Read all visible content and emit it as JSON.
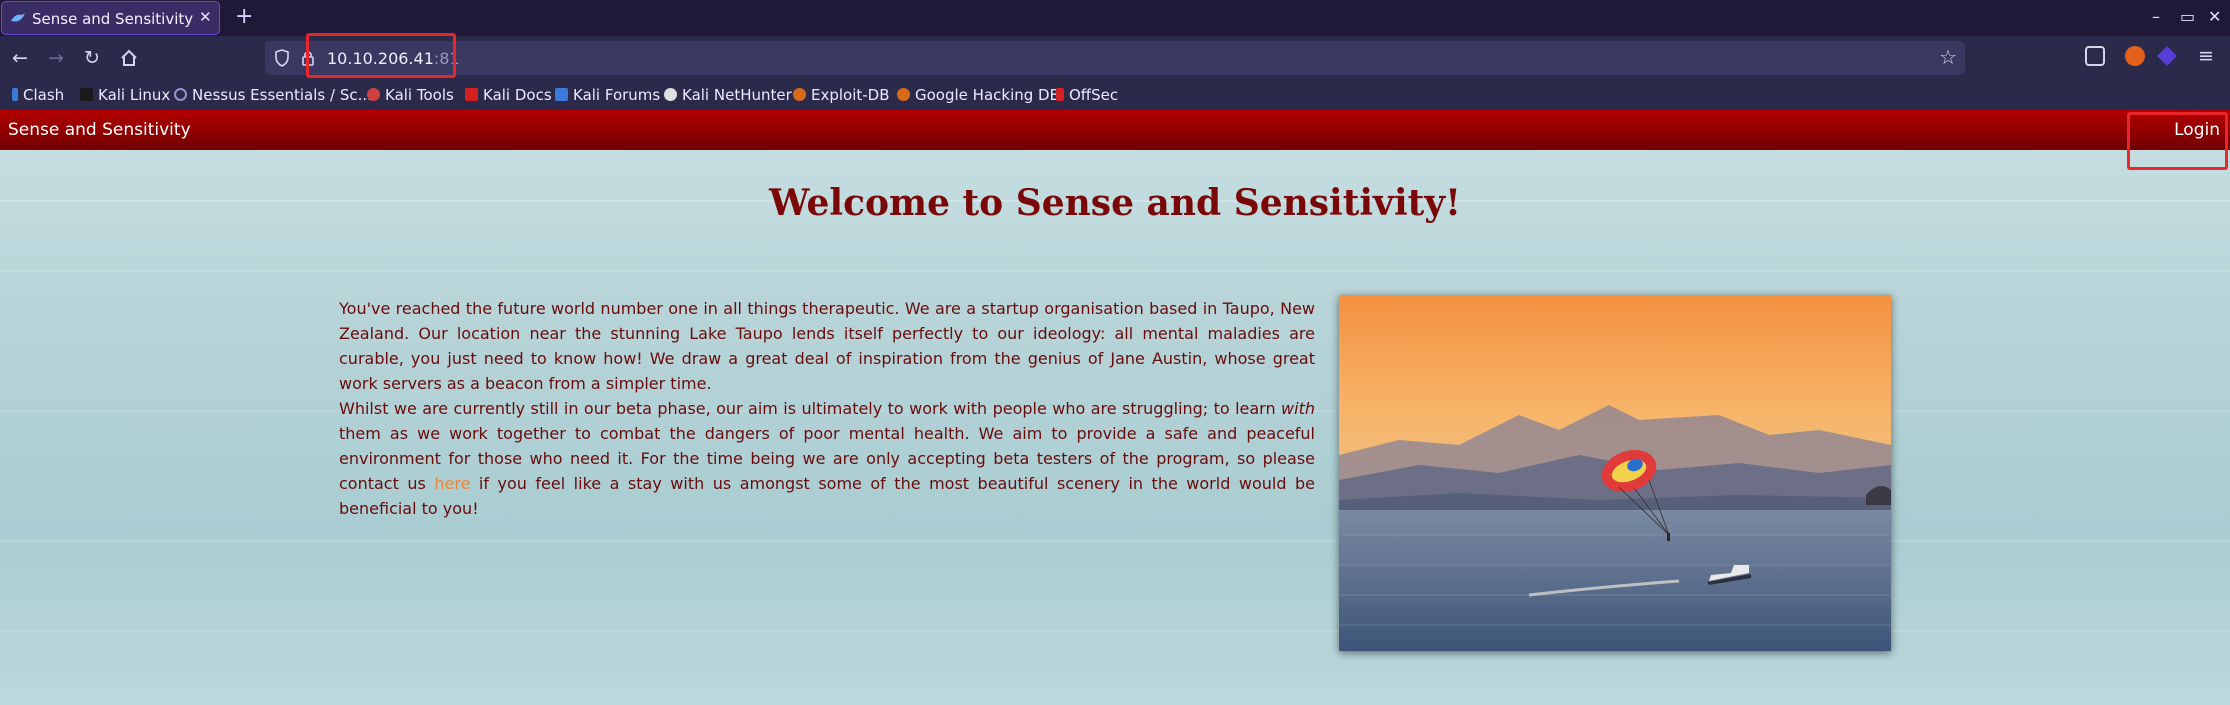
{
  "browser": {
    "tab_title": "Sense and Sensitivity",
    "tab_close": "✕",
    "new_tab": "+",
    "url_host": "10.10.206.41",
    "url_port": ":81",
    "window_controls": [
      "–",
      "▭",
      "✕"
    ]
  },
  "bookmarks": [
    {
      "label": "Clash",
      "icon": "clash-icon",
      "color": "#3b7bd6"
    },
    {
      "label": "Kali Linux",
      "icon": "kali-icon",
      "color": "#1a1a1a"
    },
    {
      "label": "Nessus Essentials / Sc...",
      "icon": "globe-icon",
      "color": "#9a8fd0"
    },
    {
      "label": "Kali Tools",
      "icon": "kali-tools-icon",
      "color": "#d04040"
    },
    {
      "label": "Kali Docs",
      "icon": "kali-docs-icon",
      "color": "#d42020"
    },
    {
      "label": "Kali Forums",
      "icon": "kali-forums-icon",
      "color": "#3a7ad8"
    },
    {
      "label": "Kali NetHunter",
      "icon": "nethunter-icon",
      "color": "#e0e0e0"
    },
    {
      "label": "Exploit-DB",
      "icon": "exploit-db-icon",
      "color": "#d86a1a"
    },
    {
      "label": "Google Hacking DB",
      "icon": "ghdb-icon",
      "color": "#d86a1a"
    },
    {
      "label": "OffSec",
      "icon": "offsec-icon",
      "color": "#d42020"
    }
  ],
  "site": {
    "brand": "Sense and Sensitivity",
    "login": "Login",
    "headline": "Welcome to Sense and Sensitivity!",
    "para1": "You've reached the future world number one in all things therapeutic. We are a startup organisation based in Taupo, New Zealand. Our location near the stunning Lake Taupo lends itself perfectly to our ideology: all mental maladies are curable, you just need to know how! We draw a great deal of inspiration from the genius of Jane Austin, whose great work servers as a beacon from a simpler time.",
    "para2_a": "Whilst we are currently still in our beta phase, our aim is ultimately to work with people who are struggling; to learn ",
    "para2_em": "with",
    "para2_b": " them as we work together to combat the dangers of poor mental health. We aim to provide a safe and peaceful environment for those who need it. For the time being we are only accepting beta testers of the program, so please contact us ",
    "para2_link": "here",
    "para2_c": " if you feel like a stay with us amongst some of the most beautiful scenery in the world would be beneficial to you!"
  },
  "colors": {
    "nav_red": "#8c0000",
    "headline": "#7a0808",
    "link": "#e8873a",
    "annotation": "#e8262b"
  }
}
